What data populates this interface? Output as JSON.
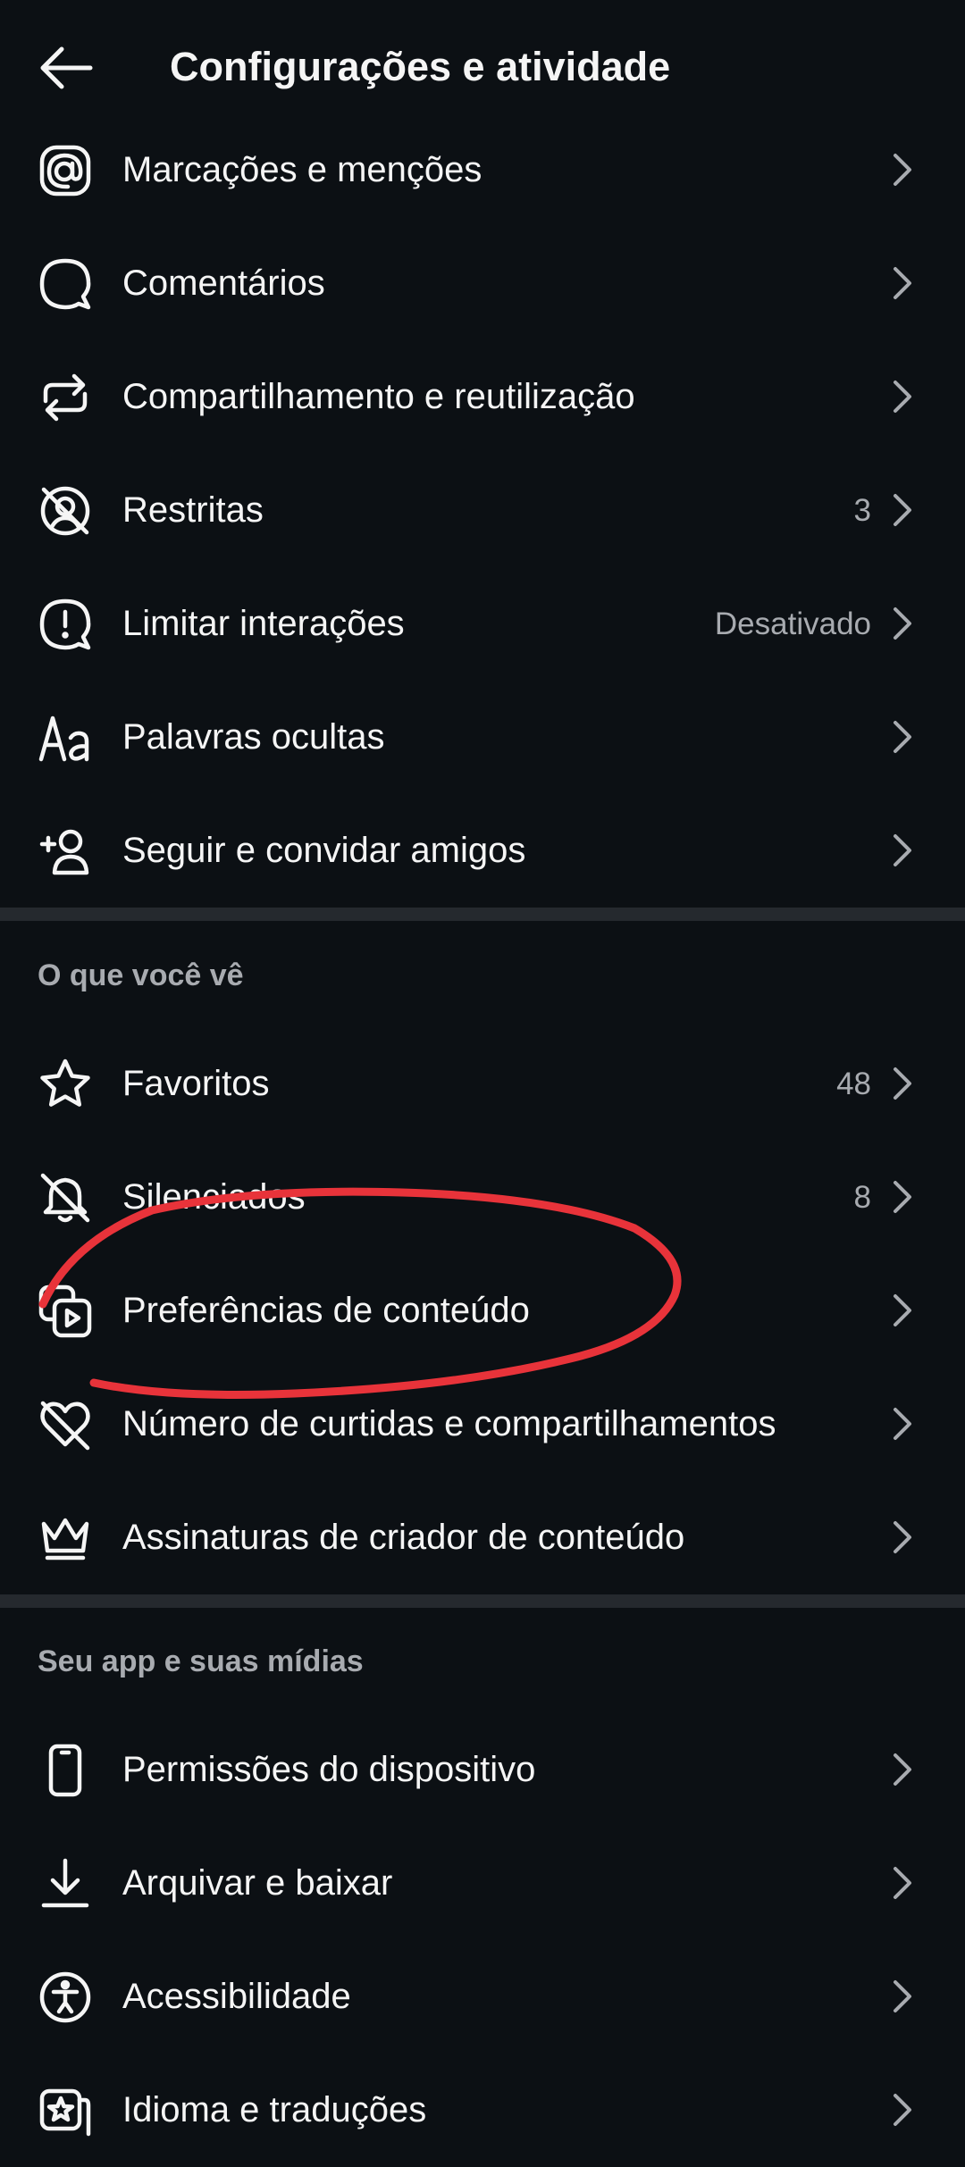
{
  "header": {
    "title": "Configurações e atividade"
  },
  "group1": {
    "items": [
      {
        "label": "Marcações e menções",
        "value": "",
        "icon": "at-sign-icon"
      },
      {
        "label": "Comentários",
        "value": "",
        "icon": "comment-bubble-icon"
      },
      {
        "label": "Compartilhamento e reutilização",
        "value": "",
        "icon": "repost-arrows-icon"
      },
      {
        "label": "Restritas",
        "value": "3",
        "icon": "restricted-user-icon"
      },
      {
        "label": "Limitar interações",
        "value": "Desativado",
        "icon": "exclamation-bubble-icon"
      },
      {
        "label": "Palavras ocultas",
        "value": "",
        "icon": "text-aa-icon"
      },
      {
        "label": "Seguir e convidar amigos",
        "value": "",
        "icon": "add-person-icon"
      }
    ]
  },
  "group2": {
    "title": "O que você vê",
    "items": [
      {
        "label": "Favoritos",
        "value": "48",
        "icon": "star-icon"
      },
      {
        "label": "Silenciados",
        "value": "8",
        "icon": "muted-bell-icon"
      },
      {
        "label": "Preferências de conteúdo",
        "value": "",
        "icon": "content-preferences-icon"
      },
      {
        "label": "Número de curtidas e compartilhamentos",
        "value": "",
        "icon": "heart-slash-icon"
      },
      {
        "label": "Assinaturas de criador de conteúdo",
        "value": "",
        "icon": "crown-icon"
      }
    ]
  },
  "group3": {
    "title": "Seu app e suas mídias",
    "items": [
      {
        "label": "Permissões do dispositivo",
        "value": "",
        "icon": "phone-icon"
      },
      {
        "label": "Arquivar e baixar",
        "value": "",
        "icon": "download-icon"
      },
      {
        "label": "Acessibilidade",
        "value": "",
        "icon": "accessibility-icon"
      },
      {
        "label": "Idioma e traduções",
        "value": "",
        "icon": "language-icon"
      }
    ]
  },
  "colors": {
    "background": "#0c1014",
    "text": "#f5f5f5",
    "secondary_text": "#a8abb0",
    "divider": "#25292e",
    "annotation": "#e8333a"
  }
}
